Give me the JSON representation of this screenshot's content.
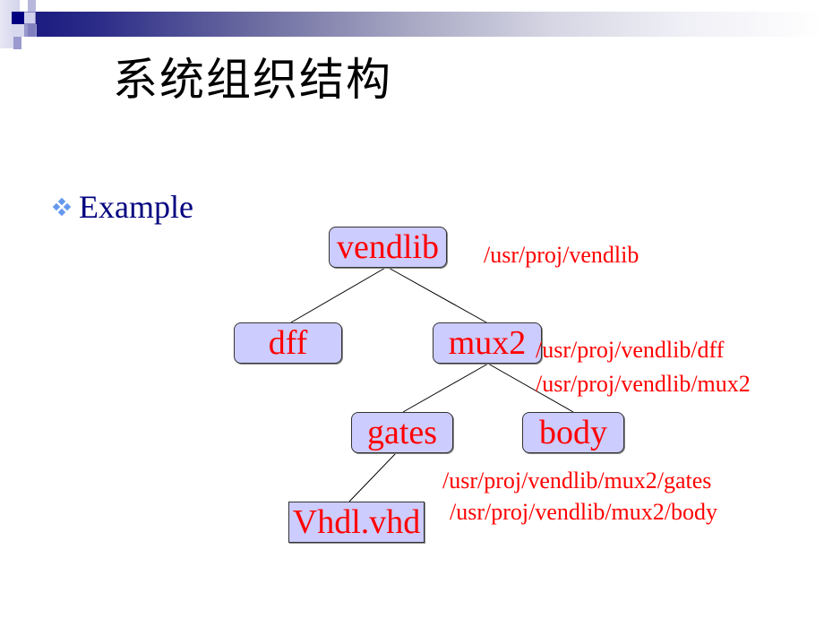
{
  "slide": {
    "title": "系统组织结构",
    "bullet": {
      "icon": "diamond-cluster-bullet-icon",
      "text": "Example"
    },
    "colors": {
      "title": "#000000",
      "bullet_text": "#000080",
      "bullet_icon": "#6699ee",
      "node_fill": "#ccccff",
      "node_text": "#ff0000",
      "path_text": "#ff0000",
      "header_band": "#1a1a80"
    }
  },
  "tree": {
    "nodes": [
      {
        "id": "vendlib",
        "label": "vendlib",
        "parent": null,
        "type": "directory"
      },
      {
        "id": "dff",
        "label": "dff",
        "parent": "vendlib",
        "type": "directory"
      },
      {
        "id": "mux2",
        "label": "mux2",
        "parent": "vendlib",
        "type": "directory"
      },
      {
        "id": "gates",
        "label": "gates",
        "parent": "mux2",
        "type": "directory"
      },
      {
        "id": "body",
        "label": "body",
        "parent": "mux2",
        "type": "directory"
      },
      {
        "id": "vhdl",
        "label": "Vhdl.vhd",
        "parent": "gates",
        "type": "file"
      }
    ],
    "paths": [
      "/usr/proj/vendlib",
      "/usr/proj/vendlib/dff",
      "/usr/proj/vendlib/mux2",
      "/usr/proj/vendlib/mux2/gates",
      "/usr/proj/vendlib/mux2/body"
    ]
  }
}
